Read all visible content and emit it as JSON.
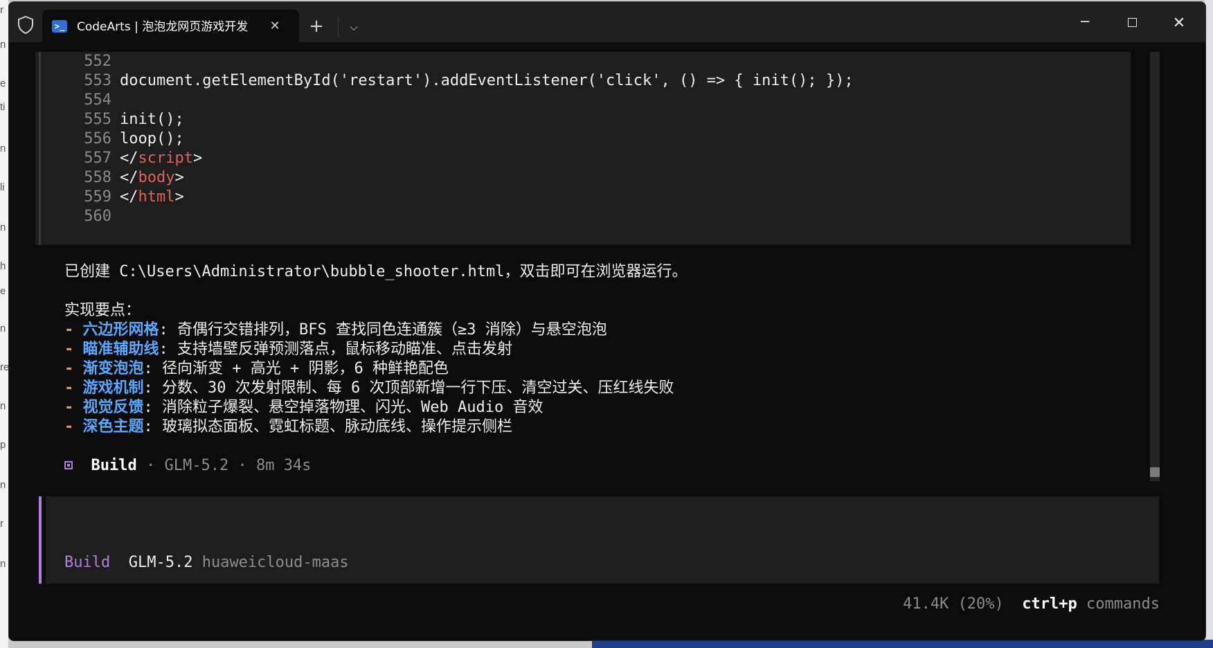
{
  "tab": {
    "title": "CodeArts | 泡泡龙网页游戏开发"
  },
  "icons": {
    "shield": "shield-icon",
    "terminal": "terminal-icon",
    "close": "close-icon",
    "plus": "plus-icon",
    "chevron": "chevron-down-icon"
  },
  "code": {
    "lines": [
      {
        "num": "552",
        "text": ""
      },
      {
        "num": "553",
        "text": "document.getElementById('restart').addEventListener('click', () => { init(); });"
      },
      {
        "num": "554",
        "text": ""
      },
      {
        "num": "555",
        "text": "init();"
      },
      {
        "num": "556",
        "text": "loop();"
      },
      {
        "num": "557",
        "pre": "</",
        "tag": "script",
        "post": ">"
      },
      {
        "num": "558",
        "pre": "</",
        "tag": "body",
        "post": ">"
      },
      {
        "num": "559",
        "pre": "</",
        "tag": "html",
        "post": ">"
      },
      {
        "num": "560",
        "text": ""
      }
    ]
  },
  "message": {
    "created": "已创建 C:\\Users\\Administrator\\bubble_shooter.html，双击即可在浏览器运行。",
    "heading": "实现要点：",
    "points": [
      {
        "dash": "-",
        "key": "六边形网格",
        "sep": ":",
        "text": " 奇偶行交错排列，BFS 查找同色连通簇（≥3 消除）与悬空泡泡"
      },
      {
        "dash": "-",
        "key": "瞄准辅助线",
        "sep": ":",
        "text": " 支持墙壁反弹预测落点，鼠标移动瞄准、点击发射"
      },
      {
        "dash": "-",
        "key": "渐变泡泡",
        "sep": ":",
        "text": " 径向渐变 + 高光 + 阴影，6 种鲜艳配色"
      },
      {
        "dash": "-",
        "key": "游戏机制",
        "sep": ":",
        "text": " 分数、30 次发射限制、每 6 次顶部新增一行下压、清空过关、压红线失败"
      },
      {
        "dash": "-",
        "key": "视觉反馈",
        "sep": ":",
        "text": " 消除粒子爆裂、悬空掉落物理、闪光、Web Audio 音效"
      },
      {
        "dash": "-",
        "key": "深色主题",
        "sep": ":",
        "text": " 玻璃拟态面板、霓虹标题、脉动底线、操作提示侧栏"
      }
    ],
    "status": {
      "label": "Build",
      "dot1": "·",
      "model": "GLM-5.2",
      "dot2": "·",
      "time": "8m 34s"
    }
  },
  "input": {
    "mode": "Build",
    "model": "GLM-5.2",
    "provider": "huaweicloud-maas"
  },
  "footer": {
    "tokens": "41.4K (20%)",
    "shortcut": "ctrl+p",
    "shortcut_label": "commands"
  },
  "colors": {
    "accent_purple": "#b07fe0",
    "bullet_orange": "#f29c38",
    "keyword_blue": "#5aa8ff",
    "tag_red": "#e0605a"
  }
}
